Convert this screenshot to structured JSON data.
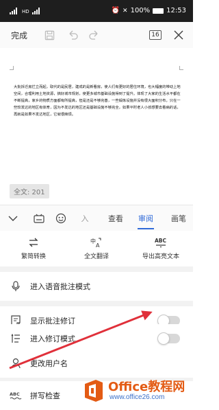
{
  "status_bar": {
    "network": "HD",
    "battery": "100%",
    "time": "12:53"
  },
  "toolbar": {
    "done_label": "完成",
    "page_count": "16"
  },
  "document": {
    "body_text": "大批拆迁房拦立而起，取代的是民居，建成的是新看房，使人们有更好的居住环境，也大幅度的带动上地空间，合理利用土地资源，搞好城市规划，使更多城市基础设施得到了提升。体现了大家的生活水平都在不断提高，家乡的物质方面都有所提高，但是还是不够完善，一些锻炼设施并没有很大面积分布，只在一些较发达的地区有体育，因为不发达的地区还是基础设施不够完全，如果平时老人小孩想要去看病的话，再就是如果不发达地区，它就很麻烦。",
    "word_count": "全文: 201"
  },
  "tab_bar": {
    "tabs": [
      "查看",
      "审阅",
      "画笔"
    ],
    "active": "审阅"
  },
  "quick_actions": [
    {
      "label": "繁简转换",
      "icon": "convert-icon"
    },
    {
      "label": "全文翻译",
      "icon": "translate-icon"
    },
    {
      "label": "导出高亮文本",
      "icon": "abc-export-icon"
    }
  ],
  "menu": {
    "voice_comment": "进入语音批注模式",
    "show_comments": "显示批注修订",
    "revision_mode": "进入修订模式",
    "change_username": "更改用户名",
    "spell_check": "拼写检查"
  },
  "watermark": {
    "name": "Office教程网",
    "url": "www.office26.com"
  },
  "colors": {
    "accent": "#2f6ad8",
    "arrow": "#e0303a",
    "watermark_orange": "#e35b14"
  }
}
